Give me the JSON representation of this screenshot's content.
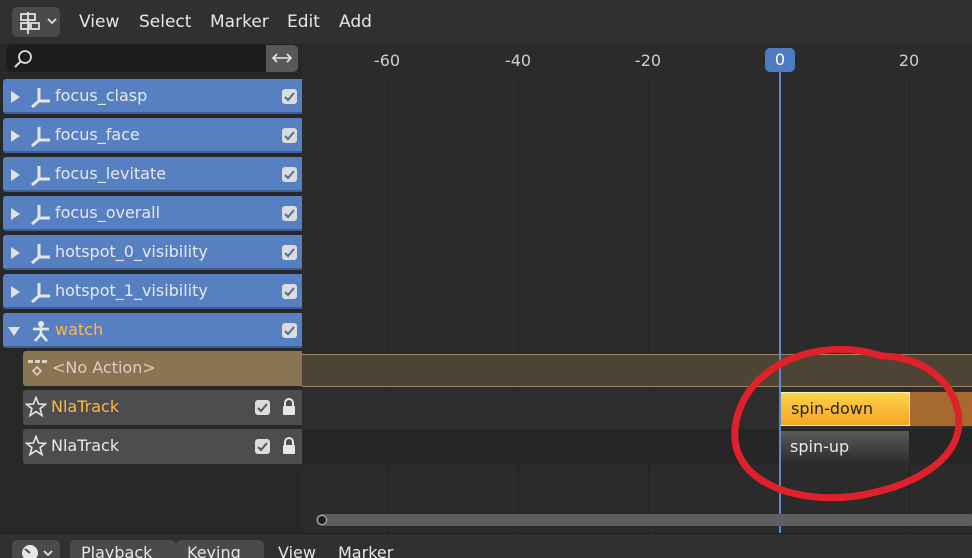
{
  "header": {
    "menus": [
      "View",
      "Select",
      "Marker",
      "Edit",
      "Add"
    ]
  },
  "search": {
    "placeholder": ""
  },
  "channels": [
    {
      "label": "focus_clasp",
      "type": "armature",
      "expanded": false,
      "checked": true
    },
    {
      "label": "focus_face",
      "type": "armature",
      "expanded": false,
      "checked": true
    },
    {
      "label": "focus_levitate",
      "type": "armature",
      "expanded": false,
      "checked": true
    },
    {
      "label": "focus_overall",
      "type": "armature",
      "expanded": false,
      "checked": true
    },
    {
      "label": "hotspot_0_visibility",
      "type": "armature",
      "expanded": false,
      "checked": true
    },
    {
      "label": "hotspot_1_visibility",
      "type": "armature",
      "expanded": false,
      "checked": true
    },
    {
      "label": "watch",
      "type": "armature-pose",
      "expanded": true,
      "checked": true
    }
  ],
  "action_row": {
    "label": "<No Action>"
  },
  "tracks": [
    {
      "label": "NlaTrack",
      "active": true,
      "checked": true,
      "locked": true
    },
    {
      "label": "NlaTrack",
      "active": false,
      "checked": true,
      "locked": true
    }
  ],
  "timeline": {
    "ticks": [
      "-60",
      "-40",
      "-20",
      "0",
      "20"
    ],
    "current_frame": "0",
    "strips": [
      {
        "label": "spin-down",
        "selected": true
      },
      {
        "label": "spin-up",
        "selected": false
      }
    ]
  },
  "footer": {
    "dropdowns": [
      "Playback",
      "Keying"
    ],
    "menus": [
      "View",
      "Marker"
    ]
  },
  "colors": {
    "channel_blue": "#5680c2",
    "selected_text": "#ffb84a",
    "playhead": "#4d7cc4",
    "strip_selected": "#f5b82e",
    "annotation_red": "#e0202a"
  }
}
